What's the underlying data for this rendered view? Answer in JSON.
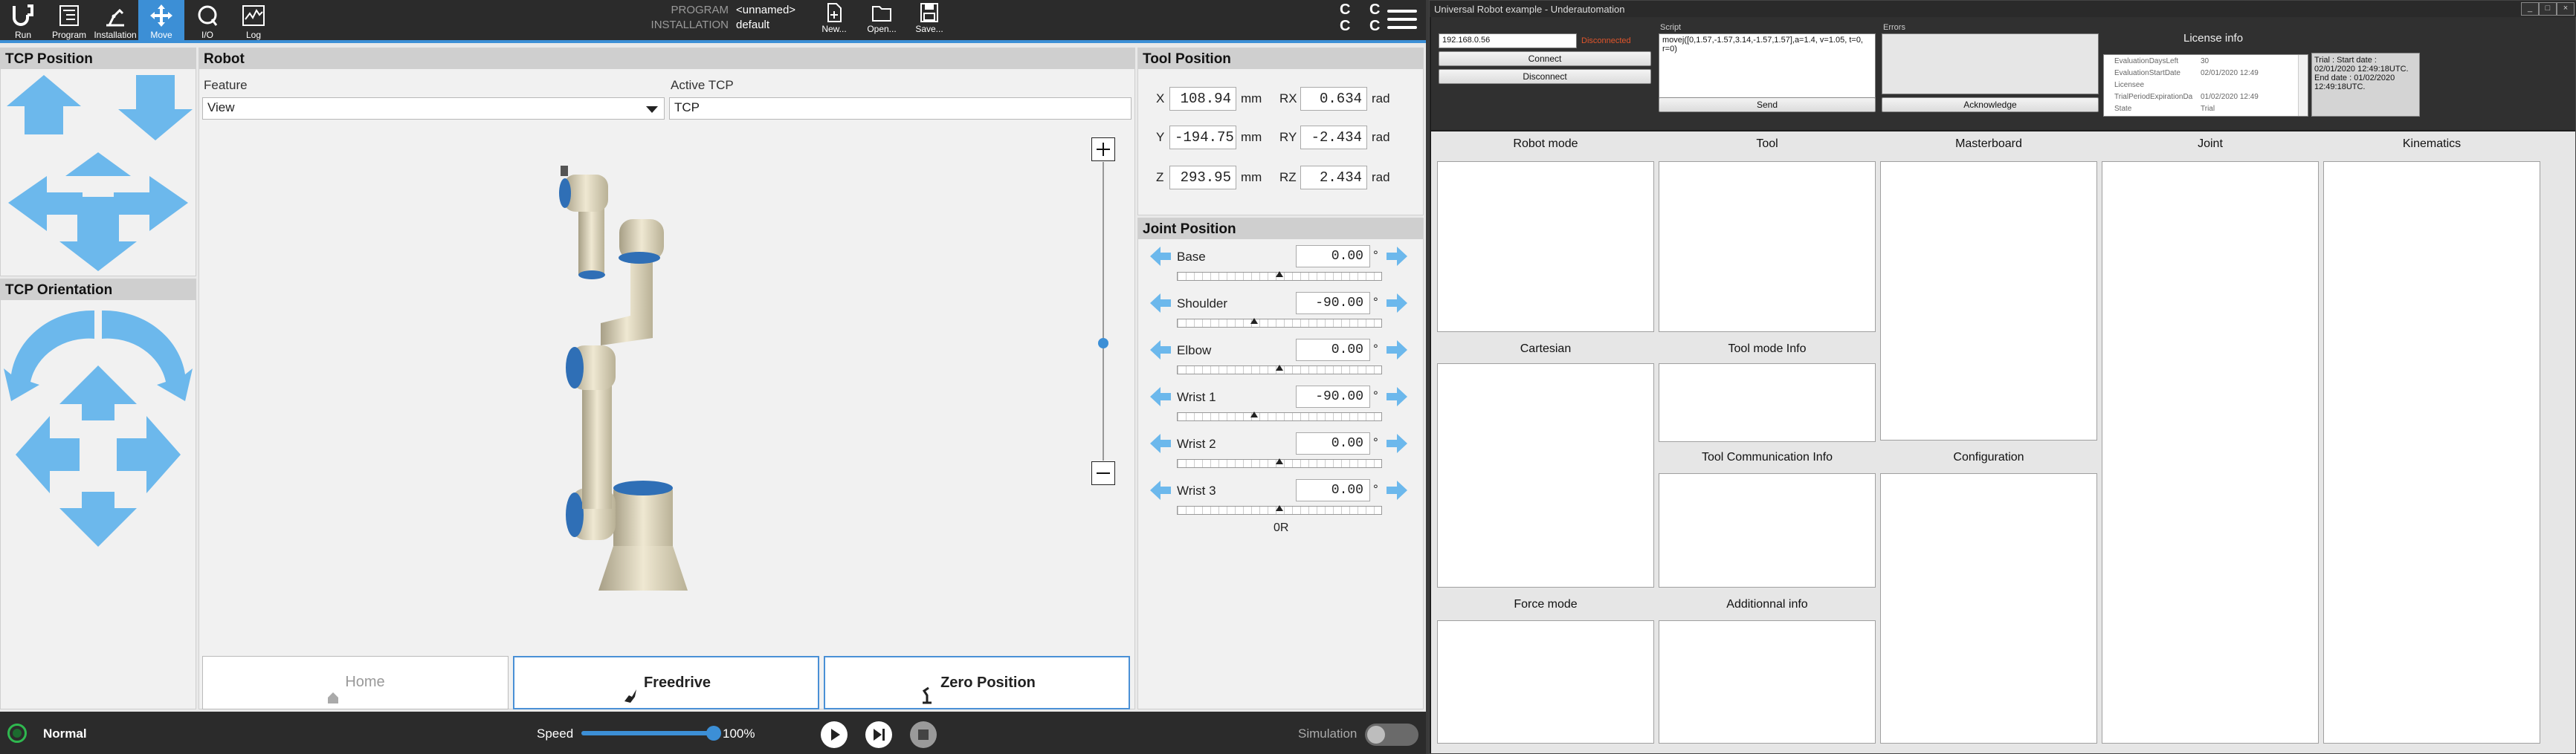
{
  "topbar": {
    "nav": [
      {
        "label": "Run",
        "icon": "ur-logo-icon"
      },
      {
        "label": "Program",
        "icon": "program-icon"
      },
      {
        "label": "Installation",
        "icon": "installation-icon"
      },
      {
        "label": "Move",
        "icon": "move-icon"
      },
      {
        "label": "I/O",
        "icon": "io-icon"
      },
      {
        "label": "Log",
        "icon": "log-icon"
      }
    ],
    "program_label": "PROGRAM",
    "program_value": "<unnamed>",
    "installation_label": "INSTALLATION",
    "installation_value": "default",
    "file_buttons": [
      {
        "label": "New...",
        "icon": "new-file-icon"
      },
      {
        "label": "Open...",
        "icon": "open-folder-icon"
      },
      {
        "label": "Save...",
        "icon": "save-icon"
      }
    ],
    "cc_top": "C C",
    "cc_bottom": "C C"
  },
  "tcp_position": {
    "title": "TCP Position"
  },
  "tcp_orientation": {
    "title": "TCP Orientation"
  },
  "robot": {
    "title": "Robot",
    "feature_label": "Feature",
    "feature_value": "View",
    "active_tcp_label": "Active TCP",
    "active_tcp_value": "TCP"
  },
  "tool_position": {
    "title": "Tool Position",
    "rows": [
      {
        "axis": "X",
        "value": "108.94",
        "unit": "mm",
        "raxis": "RX",
        "rvalue": "0.634",
        "runit": "rad"
      },
      {
        "axis": "Y",
        "value": "-194.75",
        "unit": "mm",
        "raxis": "RY",
        "rvalue": "-2.434",
        "runit": "rad"
      },
      {
        "axis": "Z",
        "value": "293.95",
        "unit": "mm",
        "raxis": "RZ",
        "rvalue": "2.434",
        "runit": "rad"
      }
    ]
  },
  "joint_position": {
    "title": "Joint Position",
    "unit": "°",
    "joints": [
      {
        "name": "Base",
        "value": "0.00",
        "level": 0.5
      },
      {
        "name": "Shoulder",
        "value": "-90.00",
        "level": 0.375
      },
      {
        "name": "Elbow",
        "value": "0.00",
        "level": 0.5
      },
      {
        "name": "Wrist 1",
        "value": "-90.00",
        "level": 0.375
      },
      {
        "name": "Wrist 2",
        "value": "0.00",
        "level": 0.5
      },
      {
        "name": "Wrist 3",
        "value": "0.00",
        "level": 0.5
      }
    ],
    "footer": "0R"
  },
  "buttons": {
    "home": "Home",
    "freedrive": "Freedrive",
    "zero_position": "Zero Position"
  },
  "footer": {
    "status": "Normal",
    "speed_label": "Speed",
    "speed_value": "100%",
    "speed_level": 1.0,
    "simulation_label": "Simulation"
  },
  "winapp": {
    "title": "Universal Robot example - Underautomation",
    "ip": "192.168.0.56",
    "connection_status": "Disconnected",
    "connect": "Connect",
    "disconnect": "Disconnect",
    "script_label": "Script",
    "script_text": "movej([0,1.57,-1.57,3.14,-1.57,1.57],a=1.4, v=1.05, t=0, r=0)",
    "send": "Send",
    "errors_label": "Errors",
    "acknowledge": "Acknowledge",
    "license_title": "License info",
    "license_rows": [
      {
        "k": "EvaluationDaysLeft",
        "v": "30"
      },
      {
        "k": "EvaluationStartDate",
        "v": "02/01/2020 12:49"
      },
      {
        "k": "Licensee",
        "v": ""
      },
      {
        "k": "TrialPeriodExpirationDa",
        "v": "01/02/2020 12:49"
      },
      {
        "k": "State",
        "v": "Trial"
      }
    ],
    "license_summary": "Trial : Start date : 02/01/2020 12:49:18UTC. End date : 01/02/2020 12:49:18UTC.",
    "groups": {
      "robot_mode": "Robot mode",
      "tool": "Tool",
      "masterboard": "Masterboard",
      "joint": "Joint",
      "kinematics": "Kinematics",
      "cartesian": "Cartesian",
      "tool_mode_info": "Tool mode Info",
      "tool_comm_info": "Tool Communication Info",
      "configuration": "Configuration",
      "force_mode": "Force mode",
      "additional_info": "Additionnal info"
    }
  },
  "colors": {
    "accent": "#3c8fd6",
    "arrow": "#6cb8ec",
    "bar": "#2b2b2b",
    "status_ok": "#2fb84f"
  }
}
